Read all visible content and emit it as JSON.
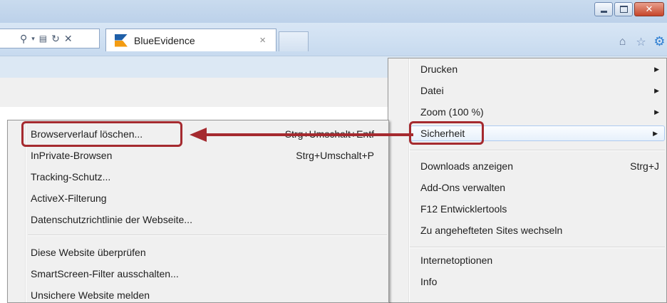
{
  "browser": {
    "tab": {
      "title": "BlueEvidence",
      "close_glyph": "×"
    },
    "address_icons": [
      "search-icon",
      "dropdown-icon",
      "compat-view-icon",
      "refresh-icon",
      "stop-icon"
    ],
    "window_buttons": [
      "minimize",
      "maximize",
      "close"
    ],
    "toolbar_icons": [
      "home-icon",
      "favorites-star-icon",
      "tools-gear-icon"
    ]
  },
  "tools_menu": {
    "items": [
      {
        "label": "Drucken",
        "submenu": true
      },
      {
        "label": "Datei",
        "submenu": true
      },
      {
        "label": "Zoom (100 %)",
        "submenu": true
      },
      {
        "label": "Sicherheit",
        "submenu": true,
        "highlighted": true
      },
      {
        "label": "Downloads anzeigen",
        "shortcut": "Strg+J"
      },
      {
        "label": "Add-Ons verwalten"
      },
      {
        "label": "F12 Entwicklertools"
      },
      {
        "label": "Zu angehefteten Sites wechseln"
      },
      {
        "label": "Internetoptionen"
      },
      {
        "label": "Info"
      }
    ]
  },
  "security_submenu": {
    "items": [
      {
        "label": "Browserverlauf löschen...",
        "shortcut": "Strg+Umschalt+Entf"
      },
      {
        "label": "InPrivate-Browsen",
        "shortcut": "Strg+Umschalt+P"
      },
      {
        "label": "Tracking-Schutz..."
      },
      {
        "label": "ActiveX-Filterung"
      },
      {
        "label": "Datenschutzrichtlinie der Webseite..."
      },
      {
        "label": "Diese Website überprüfen"
      },
      {
        "label": "SmartScreen-Filter ausschalten..."
      },
      {
        "label": "Unsichere Website melden"
      }
    ]
  },
  "annotation_color": "#a52a2f"
}
